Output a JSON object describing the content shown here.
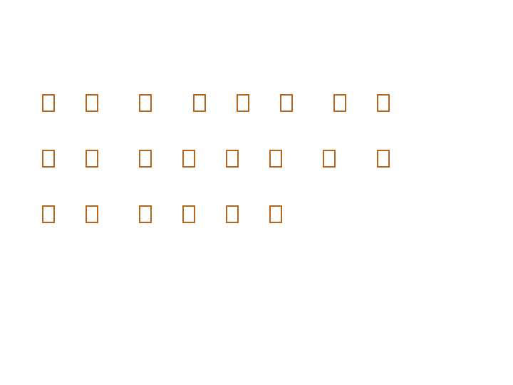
{
  "glyph_color": "#b5651d",
  "rows": [
    {
      "glyph_count": 8
    },
    {
      "glyph_count": 8
    },
    {
      "glyph_count": 6
    }
  ]
}
